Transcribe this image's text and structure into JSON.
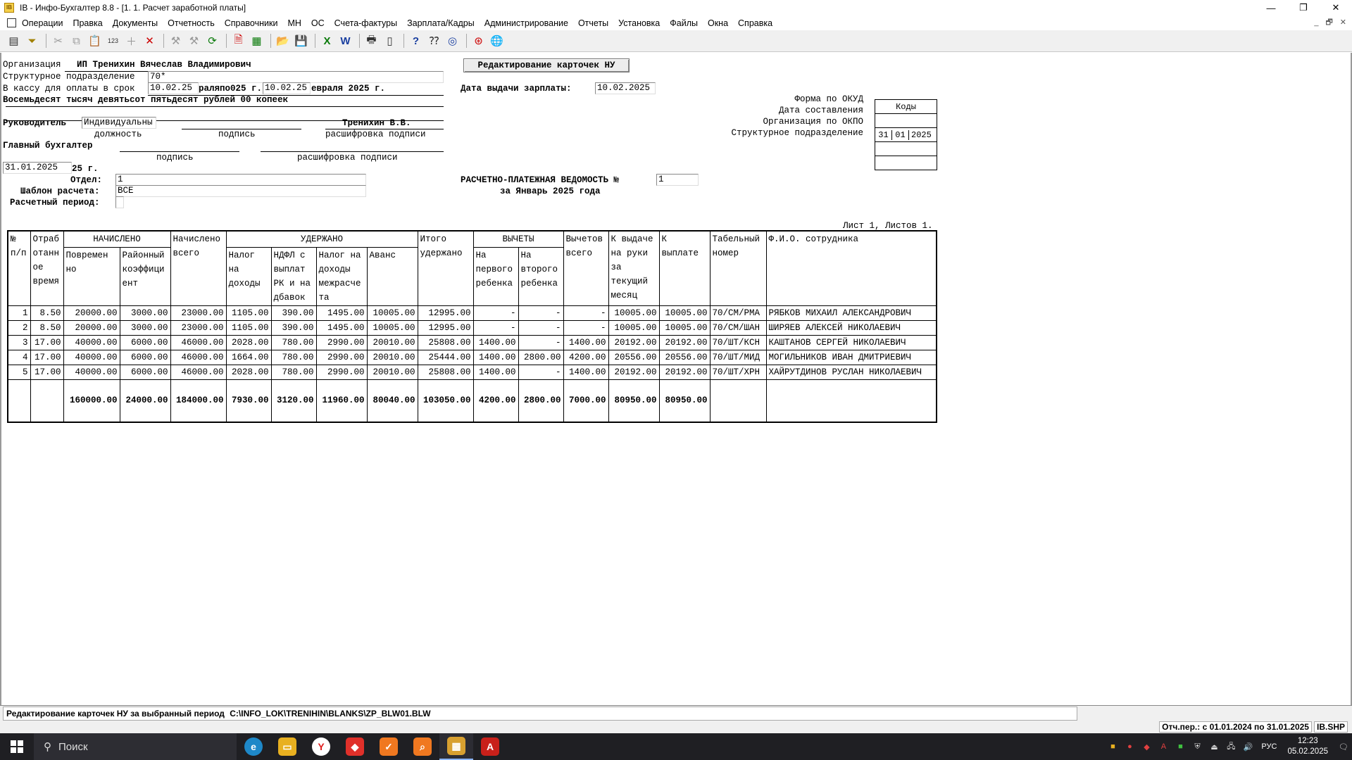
{
  "window": {
    "title": "IB - Инфо-Бухгалтер 8.8 - [1. 1. Расчет заработной платы]",
    "minimize": "—",
    "maximize": "❐",
    "close": "✕"
  },
  "menu": [
    "Операции",
    "Правка",
    "Документы",
    "Отчетность",
    "Справочники",
    "МН",
    "ОС",
    "Счета-фактуры",
    "Зарплата/Кадры",
    "Администрирование",
    "Отчеты",
    "Установка",
    "Файлы",
    "Окна",
    "Справка"
  ],
  "mdi_controls": [
    "_",
    "🗗",
    "✕"
  ],
  "toolbar_icons": [
    "form-icon",
    "filter-icon",
    "cut-icon",
    "copy-icon",
    "paste-icon",
    "numbering-icon",
    "add-icon",
    "delete-icon",
    "tool-icon",
    "tool2-icon",
    "refresh-icon",
    "pdf-doc-icon",
    "spreadsheet-icon",
    "open-folder-icon",
    "save-icon",
    "excel-icon",
    "word-icon",
    "print-icon",
    "page-icon",
    "help-icon",
    "context-help-icon",
    "compass-icon",
    "lifebuoy-icon",
    "globe-icon"
  ],
  "form": {
    "header_button": "Редактирование карточек НУ",
    "org_label": "Организация",
    "org_value": "ИП Тренихин Вячеслав Владимирович",
    "dept_label": "Структурное подразделение",
    "dept_value": "70*",
    "cash_label": "В кассу для оплаты в срок",
    "cash_from": "10.02.25",
    "cash_mid": "раляпо025 г.",
    "cash_to": "10.02.25",
    "cash_tail": "евраля 2025 г.",
    "amount_words": "Восемьдесят тысяч девятьсот пятьдесят рублей 00 копеек",
    "pay_date_label": "Дата выдачи зарплаты:",
    "pay_date_value": "10.02.2025",
    "head_label": "Руководитель",
    "head_position": "Индивидуальны",
    "head_name": "Тренихин В.В.",
    "cap_position": "должность",
    "cap_sign": "подпись",
    "cap_decode": "расшифровка подписи",
    "chief_label": "Главный бухгалтер",
    "cap_sign2": "подпись",
    "cap_decode2": "расшифровка подписи",
    "doc_date": "31.01.2025",
    "doc_date_tail": "25 г.",
    "unit_label": "Отдел:",
    "unit_value": "1",
    "template_label": "Шаблон расчета:",
    "template_value": "ВСЕ",
    "period_label": "Расчетный период:",
    "period_value": "",
    "statement_title": "РАСЧЕТНО-ПЛАТЕЖНАЯ ВЕДОМОСТЬ №",
    "statement_no": "1",
    "statement_period": "за Январь 2025 года",
    "sheet_info": "Лист 1, Листов 1.",
    "codes_header": "Коды",
    "okud_label": "Форма по ОКУД",
    "compile_date_label": "Дата составления",
    "compile_day": "31",
    "compile_month": "01",
    "compile_year": "2025",
    "okpo_label": "Организация по ОКПО",
    "struct_label": "Структурное подразделение"
  },
  "table": {
    "h_num": [
      "№",
      "п/п"
    ],
    "h_worked": [
      "Отраб",
      "отанн",
      "ое",
      "время"
    ],
    "h_accrued": "НАЧИСЛЕНО",
    "h_time": [
      "Повремен",
      "но"
    ],
    "h_region": [
      "Районный",
      "коэффици",
      "ент"
    ],
    "h_total_acc": [
      "Начислено",
      "всего"
    ],
    "h_withheld": "УДЕРЖАНО",
    "h_tax": [
      "Налог",
      "на",
      "доходы"
    ],
    "h_ndfl": [
      "НДФЛ с",
      "выплат",
      "РК и на",
      "дбавок"
    ],
    "h_tax_inter": [
      "Налог на",
      "доходы",
      "межрасче",
      "та"
    ],
    "h_advance": [
      "Аванс"
    ],
    "h_total_with": [
      "Итого",
      "удержано"
    ],
    "h_deductions": "ВЫЧЕТЫ",
    "h_first": [
      "На",
      "первого",
      "ребенка"
    ],
    "h_second": [
      "На",
      "второго",
      "ребенка"
    ],
    "h_ded_total": [
      "Вычетов",
      "всего"
    ],
    "h_topay_month": [
      "К выдаче",
      "на руки",
      "за",
      "текущий",
      "месяц"
    ],
    "h_topay": [
      "К",
      "выплате"
    ],
    "h_tab": [
      "Табельный",
      "номер"
    ],
    "h_fio": [
      "Ф.И.О. сотрудника"
    ],
    "rows": [
      [
        "1",
        "8.50",
        "20000.00",
        "3000.00",
        "23000.00",
        "1105.00",
        "390.00",
        "1495.00",
        "10005.00",
        "12995.00",
        "-",
        "-",
        "-",
        "10005.00",
        "10005.00",
        "70/СМ/РМА",
        "РЯБКОВ МИХАИЛ АЛЕКСАНДРОВИЧ"
      ],
      [
        "2",
        "8.50",
        "20000.00",
        "3000.00",
        "23000.00",
        "1105.00",
        "390.00",
        "1495.00",
        "10005.00",
        "12995.00",
        "-",
        "-",
        "-",
        "10005.00",
        "10005.00",
        "70/СМ/ШАН",
        "ШИРЯЕВ АЛЕКСЕЙ НИКОЛАЕВИЧ"
      ],
      [
        "3",
        "17.00",
        "40000.00",
        "6000.00",
        "46000.00",
        "2028.00",
        "780.00",
        "2990.00",
        "20010.00",
        "25808.00",
        "1400.00",
        "-",
        "1400.00",
        "20192.00",
        "20192.00",
        "70/ШТ/КСН",
        "КАШТАНОВ СЕРГЕЙ НИКОЛАЕВИЧ"
      ],
      [
        "4",
        "17.00",
        "40000.00",
        "6000.00",
        "46000.00",
        "1664.00",
        "780.00",
        "2990.00",
        "20010.00",
        "25444.00",
        "1400.00",
        "2800.00",
        "4200.00",
        "20556.00",
        "20556.00",
        "70/ШТ/МИД",
        "МОГИЛЬНИКОВ ИВАН ДМИТРИЕВИЧ"
      ],
      [
        "5",
        "17.00",
        "40000.00",
        "6000.00",
        "46000.00",
        "2028.00",
        "780.00",
        "2990.00",
        "20010.00",
        "25808.00",
        "1400.00",
        "-",
        "1400.00",
        "20192.00",
        "20192.00",
        "70/ШТ/ХРН",
        "ХАЙРУТДИНОВ РУСЛАН НИКОЛАЕВИЧ"
      ]
    ],
    "totals": [
      "",
      "",
      "160000.00",
      "24000.00",
      "184000.00",
      "7930.00",
      "3120.00",
      "11960.00",
      "80040.00",
      "103050.00",
      "4200.00",
      "2800.00",
      "7000.00",
      "80950.00",
      "80950.00",
      "",
      ""
    ]
  },
  "status": {
    "message": "Редактирование карточек НУ за выбранный период",
    "path": "C:\\INFO_LOK\\TRENIHIN\\BLANKS\\ZP_BLW01.BLW",
    "period": "Отч.пер.: с 01.01.2024 по 31.01.2025",
    "file": "IB.SHP"
  },
  "taskbar": {
    "search_placeholder": "Поиск",
    "lang": "РУС",
    "time": "12:23",
    "date": "05.02.2025"
  }
}
